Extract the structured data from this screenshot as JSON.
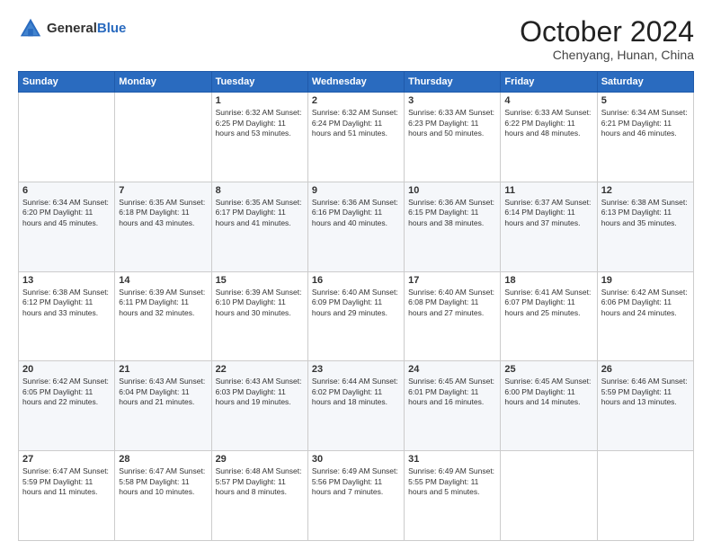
{
  "header": {
    "logo_general": "General",
    "logo_blue": "Blue",
    "month": "October 2024",
    "location": "Chenyang, Hunan, China"
  },
  "days_of_week": [
    "Sunday",
    "Monday",
    "Tuesday",
    "Wednesday",
    "Thursday",
    "Friday",
    "Saturday"
  ],
  "weeks": [
    [
      {
        "day": "",
        "info": ""
      },
      {
        "day": "",
        "info": ""
      },
      {
        "day": "1",
        "info": "Sunrise: 6:32 AM\nSunset: 6:25 PM\nDaylight: 11 hours and 53 minutes."
      },
      {
        "day": "2",
        "info": "Sunrise: 6:32 AM\nSunset: 6:24 PM\nDaylight: 11 hours and 51 minutes."
      },
      {
        "day": "3",
        "info": "Sunrise: 6:33 AM\nSunset: 6:23 PM\nDaylight: 11 hours and 50 minutes."
      },
      {
        "day": "4",
        "info": "Sunrise: 6:33 AM\nSunset: 6:22 PM\nDaylight: 11 hours and 48 minutes."
      },
      {
        "day": "5",
        "info": "Sunrise: 6:34 AM\nSunset: 6:21 PM\nDaylight: 11 hours and 46 minutes."
      }
    ],
    [
      {
        "day": "6",
        "info": "Sunrise: 6:34 AM\nSunset: 6:20 PM\nDaylight: 11 hours and 45 minutes."
      },
      {
        "day": "7",
        "info": "Sunrise: 6:35 AM\nSunset: 6:18 PM\nDaylight: 11 hours and 43 minutes."
      },
      {
        "day": "8",
        "info": "Sunrise: 6:35 AM\nSunset: 6:17 PM\nDaylight: 11 hours and 41 minutes."
      },
      {
        "day": "9",
        "info": "Sunrise: 6:36 AM\nSunset: 6:16 PM\nDaylight: 11 hours and 40 minutes."
      },
      {
        "day": "10",
        "info": "Sunrise: 6:36 AM\nSunset: 6:15 PM\nDaylight: 11 hours and 38 minutes."
      },
      {
        "day": "11",
        "info": "Sunrise: 6:37 AM\nSunset: 6:14 PM\nDaylight: 11 hours and 37 minutes."
      },
      {
        "day": "12",
        "info": "Sunrise: 6:38 AM\nSunset: 6:13 PM\nDaylight: 11 hours and 35 minutes."
      }
    ],
    [
      {
        "day": "13",
        "info": "Sunrise: 6:38 AM\nSunset: 6:12 PM\nDaylight: 11 hours and 33 minutes."
      },
      {
        "day": "14",
        "info": "Sunrise: 6:39 AM\nSunset: 6:11 PM\nDaylight: 11 hours and 32 minutes."
      },
      {
        "day": "15",
        "info": "Sunrise: 6:39 AM\nSunset: 6:10 PM\nDaylight: 11 hours and 30 minutes."
      },
      {
        "day": "16",
        "info": "Sunrise: 6:40 AM\nSunset: 6:09 PM\nDaylight: 11 hours and 29 minutes."
      },
      {
        "day": "17",
        "info": "Sunrise: 6:40 AM\nSunset: 6:08 PM\nDaylight: 11 hours and 27 minutes."
      },
      {
        "day": "18",
        "info": "Sunrise: 6:41 AM\nSunset: 6:07 PM\nDaylight: 11 hours and 25 minutes."
      },
      {
        "day": "19",
        "info": "Sunrise: 6:42 AM\nSunset: 6:06 PM\nDaylight: 11 hours and 24 minutes."
      }
    ],
    [
      {
        "day": "20",
        "info": "Sunrise: 6:42 AM\nSunset: 6:05 PM\nDaylight: 11 hours and 22 minutes."
      },
      {
        "day": "21",
        "info": "Sunrise: 6:43 AM\nSunset: 6:04 PM\nDaylight: 11 hours and 21 minutes."
      },
      {
        "day": "22",
        "info": "Sunrise: 6:43 AM\nSunset: 6:03 PM\nDaylight: 11 hours and 19 minutes."
      },
      {
        "day": "23",
        "info": "Sunrise: 6:44 AM\nSunset: 6:02 PM\nDaylight: 11 hours and 18 minutes."
      },
      {
        "day": "24",
        "info": "Sunrise: 6:45 AM\nSunset: 6:01 PM\nDaylight: 11 hours and 16 minutes."
      },
      {
        "day": "25",
        "info": "Sunrise: 6:45 AM\nSunset: 6:00 PM\nDaylight: 11 hours and 14 minutes."
      },
      {
        "day": "26",
        "info": "Sunrise: 6:46 AM\nSunset: 5:59 PM\nDaylight: 11 hours and 13 minutes."
      }
    ],
    [
      {
        "day": "27",
        "info": "Sunrise: 6:47 AM\nSunset: 5:59 PM\nDaylight: 11 hours and 11 minutes."
      },
      {
        "day": "28",
        "info": "Sunrise: 6:47 AM\nSunset: 5:58 PM\nDaylight: 11 hours and 10 minutes."
      },
      {
        "day": "29",
        "info": "Sunrise: 6:48 AM\nSunset: 5:57 PM\nDaylight: 11 hours and 8 minutes."
      },
      {
        "day": "30",
        "info": "Sunrise: 6:49 AM\nSunset: 5:56 PM\nDaylight: 11 hours and 7 minutes."
      },
      {
        "day": "31",
        "info": "Sunrise: 6:49 AM\nSunset: 5:55 PM\nDaylight: 11 hours and 5 minutes."
      },
      {
        "day": "",
        "info": ""
      },
      {
        "day": "",
        "info": ""
      }
    ]
  ]
}
